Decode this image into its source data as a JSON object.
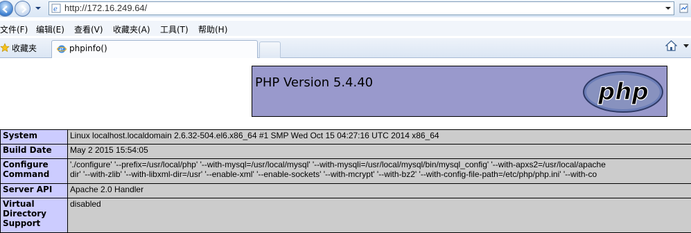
{
  "browser": {
    "url": "http://172.16.249.64/",
    "menu": [
      {
        "label": "文件(F)"
      },
      {
        "label": "编辑(E)"
      },
      {
        "label": "查看(V)"
      },
      {
        "label": "收藏夹(A)"
      },
      {
        "label": "工具(T)"
      },
      {
        "label": "帮助(H)"
      }
    ],
    "favorites_label": "收藏夹",
    "tab_title": "phpinfo()"
  },
  "php": {
    "version_title": "PHP Version 5.4.40",
    "logo_text": "php",
    "rows": [
      {
        "key": "System",
        "value": "Linux localhost.localdomain 2.6.32-504.el6.x86_64 #1 SMP Wed Oct 15 04:27:16 UTC 2014 x86_64"
      },
      {
        "key": "Build Date",
        "value": "May 2 2015 15:54:05"
      },
      {
        "key": "Configure Command",
        "value": "'./configure' '--prefix=/usr/local/php' '--with-mysql=/usr/local/mysql' '--with-mysqli=/usr/local/mysql/bin/mysql_config' '--with-apxs2=/usr/local/apache",
        "value2": "dir' '--with-zlib' '--with-libxml-dir=/usr' '--enable-xml' '--enable-sockets' '--with-mcrypt' '--with-bz2' '--with-config-file-path=/etc/php/php.ini' '--with-co"
      },
      {
        "key": "Server API",
        "value": "Apache 2.0 Handler"
      },
      {
        "key": "Virtual Directory Support",
        "value": "disabled"
      }
    ]
  },
  "colors": {
    "header_bg": "#9999cc",
    "key_bg": "#ccccff",
    "value_bg": "#cccccc"
  }
}
